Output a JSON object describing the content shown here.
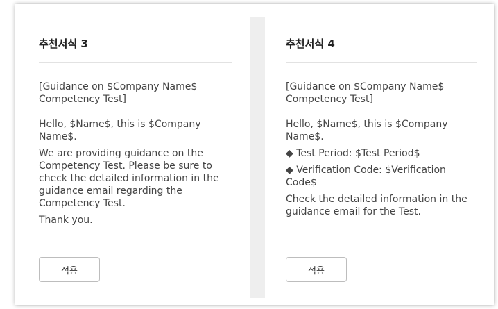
{
  "cards": [
    {
      "title": "추천서식 3",
      "subject": "[Guidance on $Company Name$ Competency Test]",
      "greeting": "Hello, $Name$, this is $Company Name$.",
      "message": "We are providing guidance on the Competency Test. Please be sure to check the detailed information in the guidance email regarding the Competency Test.",
      "closing": "Thank you.",
      "apply_label": "적용"
    },
    {
      "title": "추천서식 4",
      "subject": "[Guidance on $Company Name$ Competency Test]",
      "greeting": "Hello, $Name$, this is $Company Name$.",
      "items": [
        "◆ Test Period: $Test Period$",
        "◆ Verification Code: $Verification Code$"
      ],
      "message": "Check the detailed information in the guidance email for the Test.",
      "apply_label": "적용"
    }
  ]
}
